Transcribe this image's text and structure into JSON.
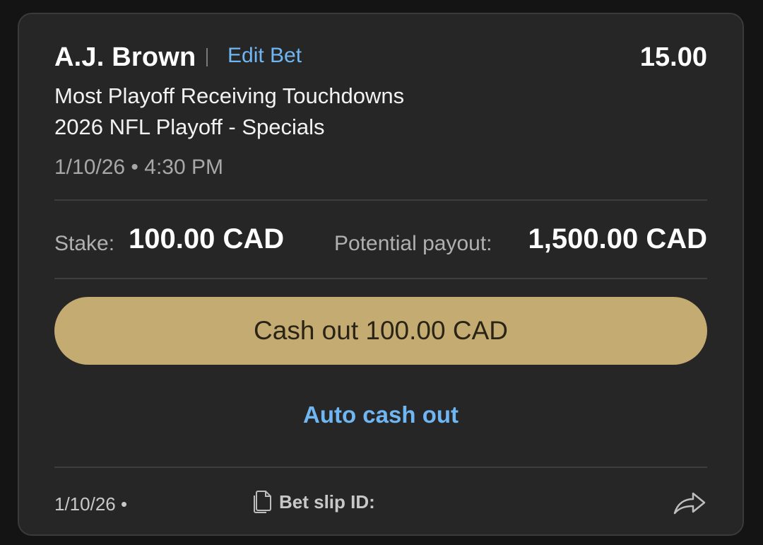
{
  "bet": {
    "selection": "A.J. Brown",
    "edit_label": "Edit Bet",
    "odds": "15.00",
    "market": "Most Playoff Receiving Touchdowns",
    "event": "2026 NFL Playoff - Specials",
    "datetime": "1/10/26 • 4:30 PM"
  },
  "amounts": {
    "stake_label": "Stake:",
    "stake_value": "100.00 CAD",
    "payout_label": "Potential payout:",
    "payout_value": "1,500.00 CAD"
  },
  "actions": {
    "cashout_label": "Cash out 100.00 CAD",
    "auto_cashout_label": "Auto cash out"
  },
  "footer": {
    "date": "1/10/26 •",
    "bet_slip_label": "Bet slip ID: ",
    "copy_icon": "copy-icon",
    "share_icon": "share-icon"
  },
  "colors": {
    "background": "#141414",
    "card": "#262626",
    "accent_link": "#6fb6f2",
    "cashout_button": "#c4ab72"
  }
}
